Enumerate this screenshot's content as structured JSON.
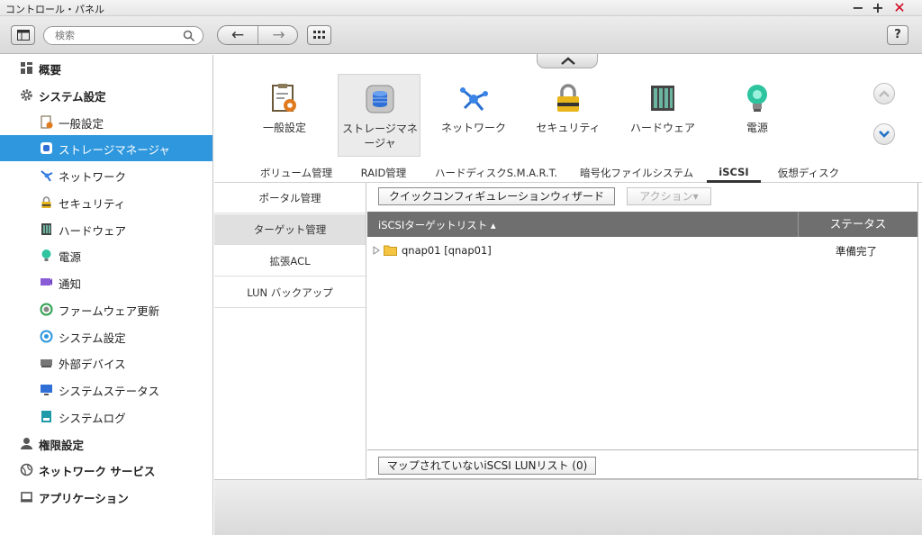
{
  "window": {
    "title": "コントロール・パネル",
    "minimize": "−",
    "maximize": "+",
    "close": "✕"
  },
  "toolbar": {
    "search_placeholder": "検索",
    "back": "←",
    "forward": "→",
    "help": "?"
  },
  "sidebar": {
    "items": [
      {
        "label": "概要",
        "icon": "overview-icon",
        "level": "top"
      },
      {
        "label": "システム設定",
        "icon": "gear-icon",
        "level": "top"
      },
      {
        "label": "一般設定",
        "icon": "general-settings-icon",
        "level": "sub"
      },
      {
        "label": "ストレージマネージャ",
        "icon": "storage-icon",
        "level": "sub",
        "active": true
      },
      {
        "label": "ネットワーク",
        "icon": "network-icon",
        "level": "sub"
      },
      {
        "label": "セキュリティ",
        "icon": "lock-icon",
        "level": "sub"
      },
      {
        "label": "ハードウェア",
        "icon": "hardware-icon",
        "level": "sub"
      },
      {
        "label": "電源",
        "icon": "power-bulb-icon",
        "level": "sub"
      },
      {
        "label": "通知",
        "icon": "notification-icon",
        "level": "sub"
      },
      {
        "label": "ファームウェア更新",
        "icon": "firmware-icon",
        "level": "sub"
      },
      {
        "label": "システム設定",
        "icon": "system-settings-icon",
        "level": "sub"
      },
      {
        "label": "外部デバイス",
        "icon": "external-device-icon",
        "level": "sub"
      },
      {
        "label": "システムステータス",
        "icon": "monitor-icon",
        "level": "sub"
      },
      {
        "label": "システムログ",
        "icon": "log-icon",
        "level": "sub"
      },
      {
        "label": "権限設定",
        "icon": "user-icon",
        "level": "top"
      },
      {
        "label": "ネットワーク サービス",
        "icon": "globe-icon",
        "level": "top"
      },
      {
        "label": "アプリケーション",
        "icon": "application-icon",
        "level": "top"
      }
    ]
  },
  "apps": {
    "general": "一般設定",
    "storage_line1": "ストレージマネ",
    "storage_line2": "ージャ",
    "network": "ネットワーク",
    "security": "セキュリティ",
    "hardware": "ハードウェア",
    "power": "電源"
  },
  "tabs": [
    "ボリューム管理",
    "RAID管理",
    "ハードディスクS.M.A.R.T.",
    "暗号化ファイルシステム",
    "iSCSI",
    "仮想ディスク"
  ],
  "active_tab": "iSCSI",
  "left_panel": [
    "ポータル管理",
    "ターゲット管理",
    "拡張ACL",
    "LUN バックアップ"
  ],
  "left_panel_active": "ターゲット管理",
  "content": {
    "quick_config_button": "クイックコンフィギュレーションウィザード",
    "action_button": "アクション▾",
    "grid_header_name": "iSCSIターゲットリスト ▴",
    "grid_header_status": "ステータス",
    "rows": [
      {
        "name": "qnap01 [qnap01]",
        "status": "準備完了"
      }
    ],
    "unmapped_button": "マップされていないiSCSI LUNリスト (0)"
  },
  "colors": {
    "accent": "#2f97dd",
    "grid_header": "#6f6f6f",
    "close": "#d0021b"
  }
}
